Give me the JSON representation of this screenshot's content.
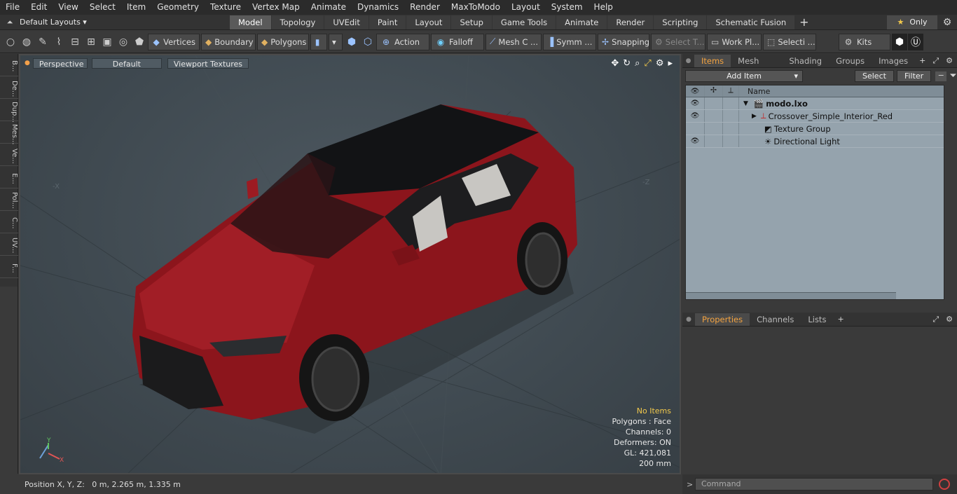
{
  "menu": [
    "File",
    "Edit",
    "View",
    "Select",
    "Item",
    "Geometry",
    "Texture",
    "Vertex Map",
    "Animate",
    "Dynamics",
    "Render",
    "MaxToModo",
    "Layout",
    "System",
    "Help"
  ],
  "layouts": {
    "label": "Default Layouts ▾",
    "only": "Only"
  },
  "modes": [
    "Model",
    "Topology",
    "UVEdit",
    "Paint",
    "Layout",
    "Setup",
    "Game Tools",
    "Animate",
    "Render",
    "Scripting",
    "Schematic Fusion"
  ],
  "toolbar": {
    "vertices": "Vertices",
    "boundary": "Boundary",
    "polygons": "Polygons",
    "action": "Action",
    "falloff": "Falloff",
    "meshc": "Mesh C ...",
    "symm": "Symm ...",
    "snapping": "Snapping",
    "selectt": "Select T...",
    "workpl": "Work Pl...",
    "selecti": "Selecti ...",
    "kits": "Kits"
  },
  "lefttabs": [
    "B...",
    "De...",
    "Dup...",
    "Mes...",
    "Ve...",
    "E...",
    "Pol...",
    "C...",
    "UV...",
    "F..."
  ],
  "viewport": {
    "perspective": "Perspective",
    "default": "Default",
    "textures": "Viewport Textures"
  },
  "info": {
    "noitems": "No Items",
    "polygons": "Polygons : Face",
    "channels": "Channels: 0",
    "deformers": "Deformers: ON",
    "gl": "GL: 421,081",
    "scale": "200 mm"
  },
  "status": {
    "position": "Position X, Y, Z:   0 m, 2.265 m, 1.335 m"
  },
  "itemstabs": [
    "Items",
    "Mesh Ops",
    "Shading",
    "Groups",
    "Images"
  ],
  "items": {
    "add": "Add Item",
    "select": "Select",
    "filter": "Filter",
    "name_col": "Name"
  },
  "tree": [
    {
      "label": "modo.lxo"
    },
    {
      "label": "Crossover_Simple_Interior_Red"
    },
    {
      "label": "Texture Group"
    },
    {
      "label": "Directional Light"
    }
  ],
  "proptabs": [
    "Properties",
    "Channels",
    "Lists"
  ],
  "command": {
    "placeholder": "Command"
  }
}
